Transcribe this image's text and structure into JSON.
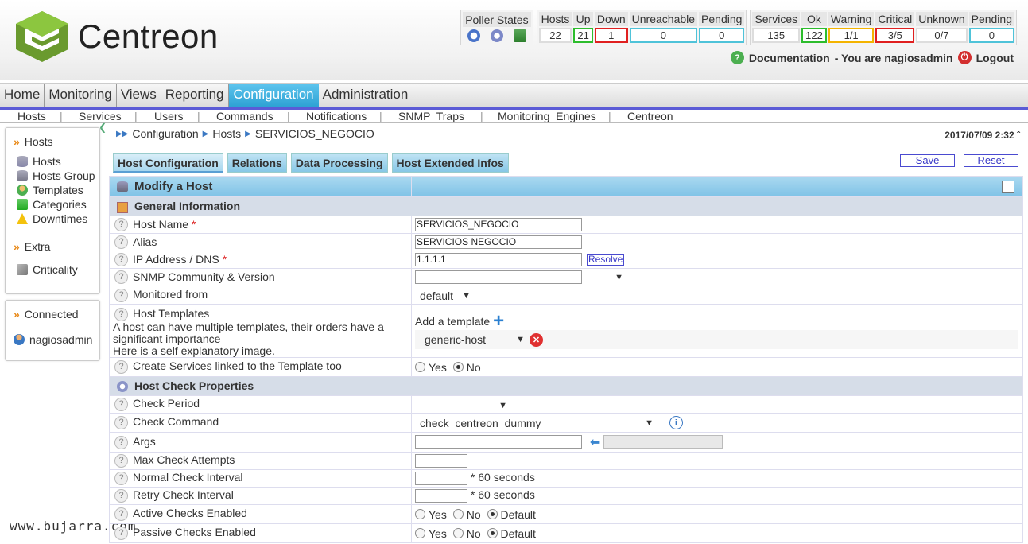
{
  "app": {
    "logo_text": "Centreon"
  },
  "status": {
    "poller": {
      "header": "Poller States"
    },
    "hosts": {
      "headers": [
        "Hosts",
        "Up",
        "Down",
        "Unreachable",
        "Pending"
      ],
      "values": [
        "22",
        "21",
        "1",
        "0",
        "0"
      ]
    },
    "services": {
      "headers": [
        "Services",
        "Ok",
        "Warning",
        "Critical",
        "Unknown",
        "Pending"
      ],
      "values": [
        "135",
        "122",
        "1/1",
        "3/5",
        "0/7",
        "0"
      ]
    },
    "colors": {
      "up": "#2dbd2d",
      "down": "#e02020",
      "pending": "#4fc3d9",
      "warning": "#f4b400"
    }
  },
  "userbar": {
    "documentation": "Documentation",
    "you_are": "- You are nagiosadmin",
    "logout": "Logout"
  },
  "mainnav": [
    "Home",
    "Monitoring",
    "Views",
    "Reporting",
    "Configuration",
    "Administration"
  ],
  "subnav": [
    "Hosts",
    "Services",
    "Users",
    "Commands",
    "Notifications",
    "SNMP  Traps",
    "Monitoring  Engines",
    "Centreon"
  ],
  "sidebar": {
    "hosts_title": "Hosts",
    "hosts_items": [
      "Hosts",
      "Hosts Group",
      "Templates",
      "Categories",
      "Downtimes"
    ],
    "extra_title": "Extra",
    "extra_items": [
      "Criticality"
    ],
    "connected_title": "Connected",
    "connected_user": "nagiosadmin"
  },
  "watermark": "www.bujarra.com",
  "breadcrumb": [
    "Configuration",
    "Hosts",
    "SERVICIOS_NEGOCIO"
  ],
  "datetime": "2017/07/09 2:32",
  "tabs": [
    "Host Configuration",
    "Relations",
    "Data Processing",
    "Host Extended Infos"
  ],
  "actions": {
    "save": "Save",
    "reset": "Reset"
  },
  "form": {
    "title": "Modify a Host",
    "general_section": "General Information",
    "host_name_label": "Host Name",
    "host_name_value": "SERVICIOS_NEGOCIO",
    "alias_label": "Alias",
    "alias_value": "SERVICIOS NEGOCIO",
    "ip_label": "IP Address / DNS",
    "ip_value": "1.1.1.1",
    "resolve": "Resolve",
    "snmp_label": "SNMP Community & Version",
    "monitored_label": "Monitored from",
    "monitored_value": "default",
    "templates_label": "Host Templates",
    "templates_desc1": "A host can have multiple templates, their orders have a significant importance",
    "templates_desc2": "Here is a self explanatory image.",
    "add_template": "Add a template",
    "template_value": "generic-host",
    "create_services_label": "Create Services linked to the Template too",
    "yes": "Yes",
    "no": "No",
    "default": "Default",
    "check_section": "Host Check Properties",
    "check_period_label": "Check Period",
    "check_command_label": "Check Command",
    "check_command_value": "check_centreon_dummy",
    "args_label": "Args",
    "max_attempts_label": "Max Check Attempts",
    "normal_interval_label": "Normal Check Interval",
    "retry_interval_label": "Retry Check Interval",
    "seconds": "* 60 seconds",
    "active_checks_label": "Active Checks Enabled",
    "passive_checks_label": "Passive Checks Enabled"
  }
}
